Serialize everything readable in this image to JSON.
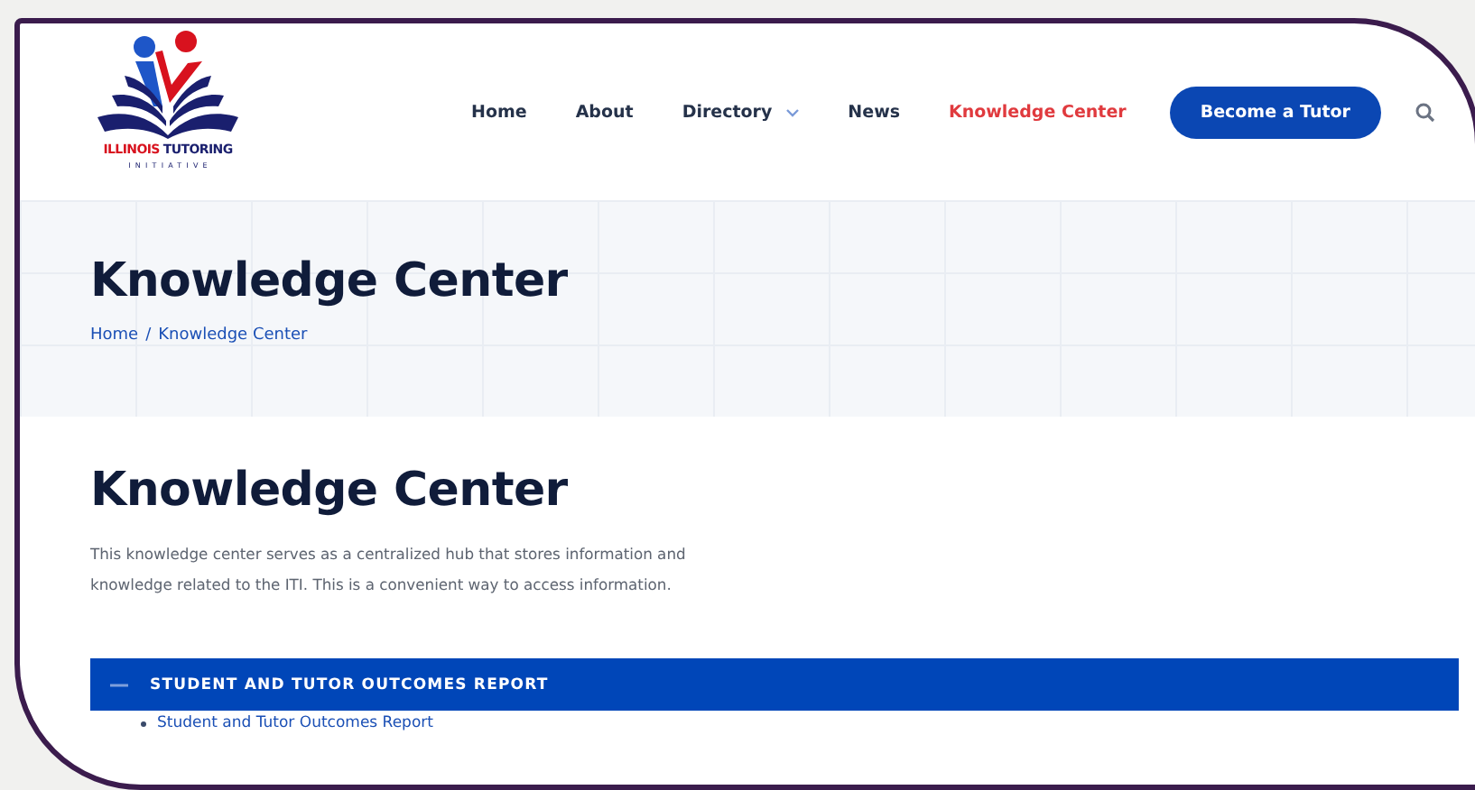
{
  "logo": {
    "word_1": "ILLINOIS",
    "word_2": "TUTORING",
    "subtitle": "INITIATIVE"
  },
  "nav": [
    {
      "label": "Home",
      "selected": false,
      "dropdown": false
    },
    {
      "label": "About",
      "selected": false,
      "dropdown": false
    },
    {
      "label": "Directory",
      "selected": false,
      "dropdown": true
    },
    {
      "label": "News",
      "selected": false,
      "dropdown": false
    },
    {
      "label": "Knowledge Center",
      "selected": true,
      "dropdown": false
    }
  ],
  "cta": {
    "label": "Become a Tutor"
  },
  "hero": {
    "title": "Knowledge Center",
    "breadcrumb": [
      "Home",
      "/",
      "Knowledge Center"
    ]
  },
  "content": {
    "heading": "Knowledge Center",
    "description": "This knowledge center serves as a centralized hub that stores information and knowledge related to the ITI. This is a convenient way to access information.",
    "accordion": [
      {
        "title": "STUDENT AND TUTOR OUTCOMES REPORT",
        "expanded": true,
        "links": [
          "Student and Tutor Outcomes Report"
        ]
      }
    ]
  }
}
